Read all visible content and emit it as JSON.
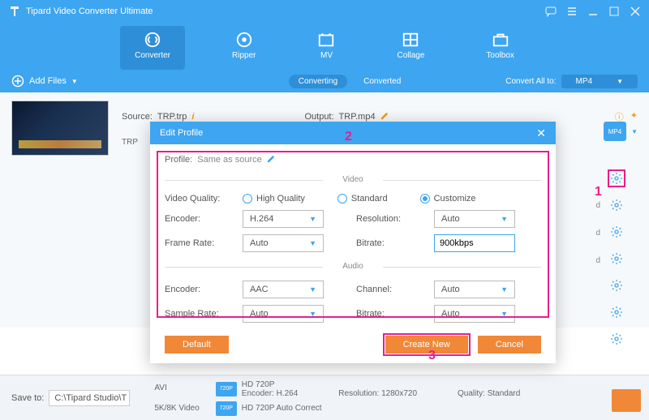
{
  "app": {
    "title": "Tipard Video Converter Ultimate"
  },
  "tabs": {
    "converter": "Converter",
    "ripper": "Ripper",
    "mv": "MV",
    "collage": "Collage",
    "toolbox": "Toolbox"
  },
  "sub": {
    "addfiles": "Add Files",
    "converting": "Converting",
    "converted": "Converted",
    "convertall": "Convert All to:",
    "format": "MP4"
  },
  "src": {
    "label": "Source:",
    "file": "TRP.trp",
    "short": "TRP"
  },
  "out": {
    "label": "Output:",
    "file": "TRP.mp4"
  },
  "save": {
    "label": "Save to:",
    "path": "C:\\Tipard Studio\\T"
  },
  "sideformats": {
    "avi": "AVI",
    "fk": "5K/8K Video"
  },
  "bottomlist": {
    "a": {
      "name": "HD 720P",
      "enc": "Encoder: H.264",
      "res": "Resolution: 1280x720",
      "q": "Quality: Standard"
    },
    "b": {
      "name": "HD 720P Auto Correct"
    }
  },
  "rlabel": "d",
  "modal": {
    "title": "Edit Profile",
    "profilelabel": "Profile:",
    "profile": "Same as source",
    "videosect": "Video",
    "audiosect": "Audio",
    "vq": "Video Quality:",
    "hq": "High Quality",
    "std": "Standard",
    "cust": "Customize",
    "encoder": "Encoder:",
    "venc": "H.264",
    "res": "Resolution:",
    "auto": "Auto",
    "fr": "Frame Rate:",
    "br": "Bitrate:",
    "brval": "900kbps",
    "aenc": "AAC",
    "ch": "Channel:",
    "sr": "Sample Rate:",
    "default": "Default",
    "create": "Create New",
    "cancel": "Cancel"
  },
  "annot": {
    "a1": "1",
    "a2": "2",
    "a3": "3"
  },
  "fmtbadge": "MP4"
}
